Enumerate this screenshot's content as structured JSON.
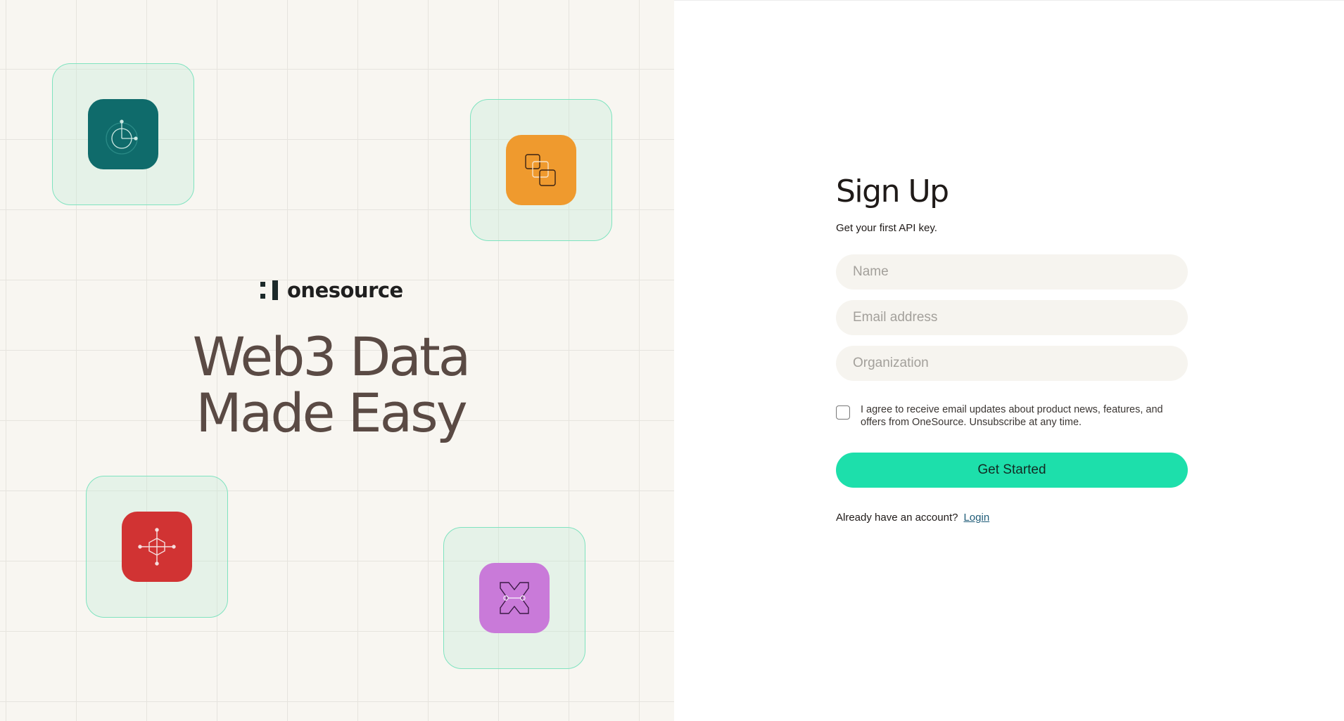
{
  "hero": {
    "brand_name": "onesource",
    "headline_line1": "Web3 Data",
    "headline_line2": "Made Easy"
  },
  "tiles": [
    {
      "name": "teal-tile",
      "icon": "radar-icon",
      "color": "#0f6b6b"
    },
    {
      "name": "orange-tile",
      "icon": "stacked-squares-icon",
      "color": "#ef9a2e"
    },
    {
      "name": "red-tile",
      "icon": "hexagon-crosshair-icon",
      "color": "#d13333"
    },
    {
      "name": "purple-tile",
      "icon": "x-link-icon",
      "color": "#c97ad9"
    }
  ],
  "form": {
    "title": "Sign Up",
    "subtitle": "Get your first API key.",
    "name_placeholder": "Name",
    "email_placeholder": "Email address",
    "organization_placeholder": "Organization",
    "consent_text": "I agree to receive email updates about product news, features, and offers from OneSource. Unsubscribe at any time.",
    "consent_checked": false,
    "submit_label": "Get Started",
    "login_prompt": "Already have an account?",
    "login_link": "Login"
  },
  "colors": {
    "accent": "#1ddfab",
    "panel_bg": "#f8f6f1",
    "tile_border": "#7fe3bf",
    "link": "#1f5c78"
  }
}
